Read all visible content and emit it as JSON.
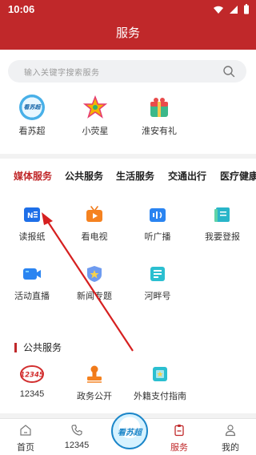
{
  "status": {
    "time": "10:06"
  },
  "header": {
    "title": "服务"
  },
  "search": {
    "placeholder": "输入关键字搜索服务"
  },
  "quick_links": [
    {
      "label": "看苏超",
      "badge": "看苏超"
    },
    {
      "label": "小荧星"
    },
    {
      "label": "淮安有礼"
    }
  ],
  "tabs": [
    "媒体服务",
    "公共服务",
    "生活服务",
    "交通出行",
    "医疗健康"
  ],
  "media_services": [
    {
      "label": "读报纸"
    },
    {
      "label": "看电视"
    },
    {
      "label": "听广播"
    },
    {
      "label": "我要登报"
    },
    {
      "label": "活动直播"
    },
    {
      "label": "新闻专题"
    },
    {
      "label": "河畔号"
    }
  ],
  "public_section": {
    "title": "公共服务",
    "items": [
      {
        "label": "12345",
        "badge": "12345"
      },
      {
        "label": "政务公开"
      },
      {
        "label": "外籍支付指南"
      }
    ]
  },
  "bottom_nav": [
    {
      "label": "首页"
    },
    {
      "label": "12345"
    },
    {
      "label": "服务"
    },
    {
      "label": "我的"
    }
  ],
  "center_logo": {
    "text": "看苏超"
  },
  "colors": {
    "brand": "#c0282a"
  }
}
